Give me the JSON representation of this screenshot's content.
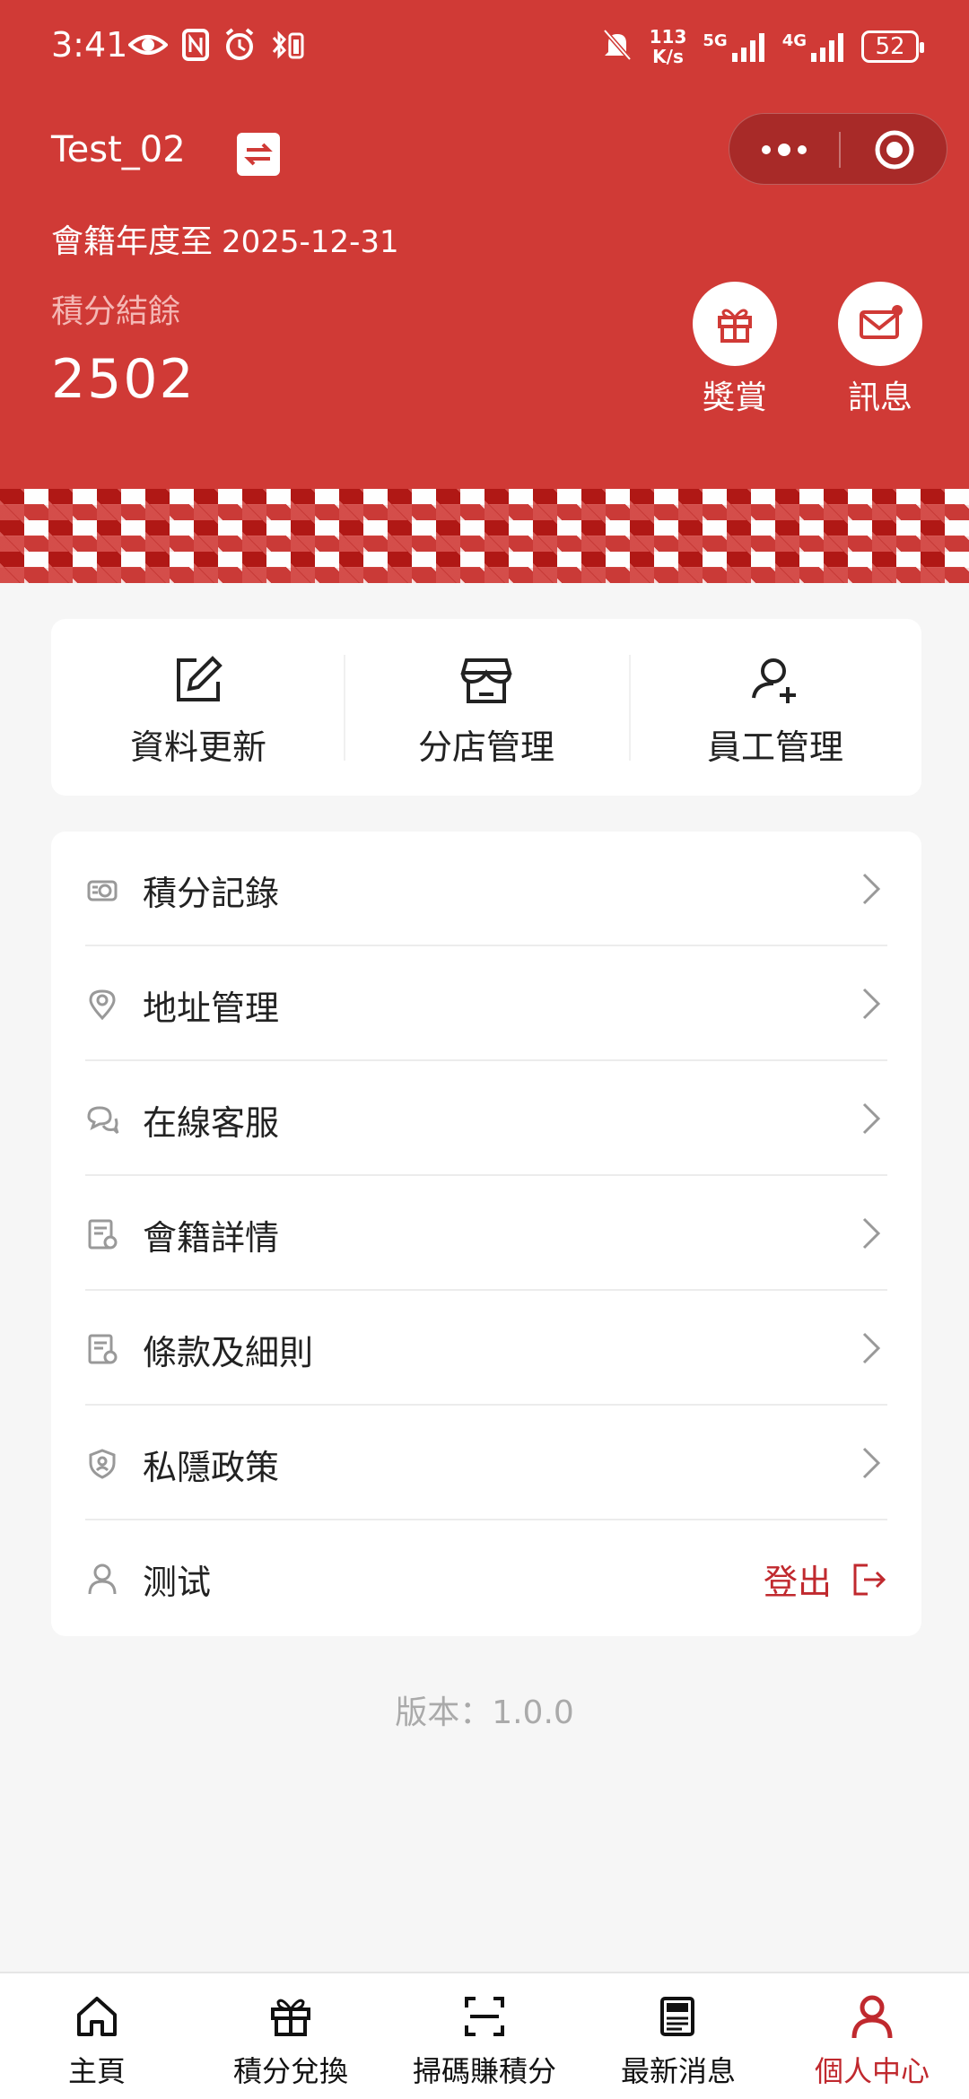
{
  "status_bar": {
    "time": "3:41",
    "net_speed_value": "113",
    "net_speed_unit": "K/s",
    "signal_1": "5G",
    "signal_2": "4G",
    "battery": "52"
  },
  "header": {
    "account_name": "Test_02",
    "membership_label": "會籍年度至",
    "membership_date": "2025-12-31",
    "points_label": "積分結餘",
    "points_value": "2502",
    "rewards_label": "獎賞",
    "messages_label": "訊息",
    "accent_color": "#d03a36"
  },
  "quick_actions": [
    {
      "label": "資料更新",
      "icon": "edit-icon"
    },
    {
      "label": "分店管理",
      "icon": "store-icon"
    },
    {
      "label": "員工管理",
      "icon": "user-add-icon"
    }
  ],
  "menu": [
    {
      "label": "積分記錄",
      "icon": "coins-icon"
    },
    {
      "label": "地址管理",
      "icon": "location-icon"
    },
    {
      "label": "在線客服",
      "icon": "chat-icon"
    },
    {
      "label": "會籍詳情",
      "icon": "document-icon"
    },
    {
      "label": "條款及細則",
      "icon": "document-icon"
    },
    {
      "label": "私隱政策",
      "icon": "shield-icon"
    }
  ],
  "user_row": {
    "name": "测试",
    "logout_label": "登出"
  },
  "version": "版本：1.0.0",
  "tabbar": [
    {
      "label": "主頁",
      "icon": "home-icon"
    },
    {
      "label": "積分兌換",
      "icon": "gift-icon"
    },
    {
      "label": "掃碼賺積分",
      "icon": "scan-icon"
    },
    {
      "label": "最新消息",
      "icon": "news-icon"
    },
    {
      "label": "個人中心",
      "icon": "person-icon",
      "active": true
    }
  ]
}
